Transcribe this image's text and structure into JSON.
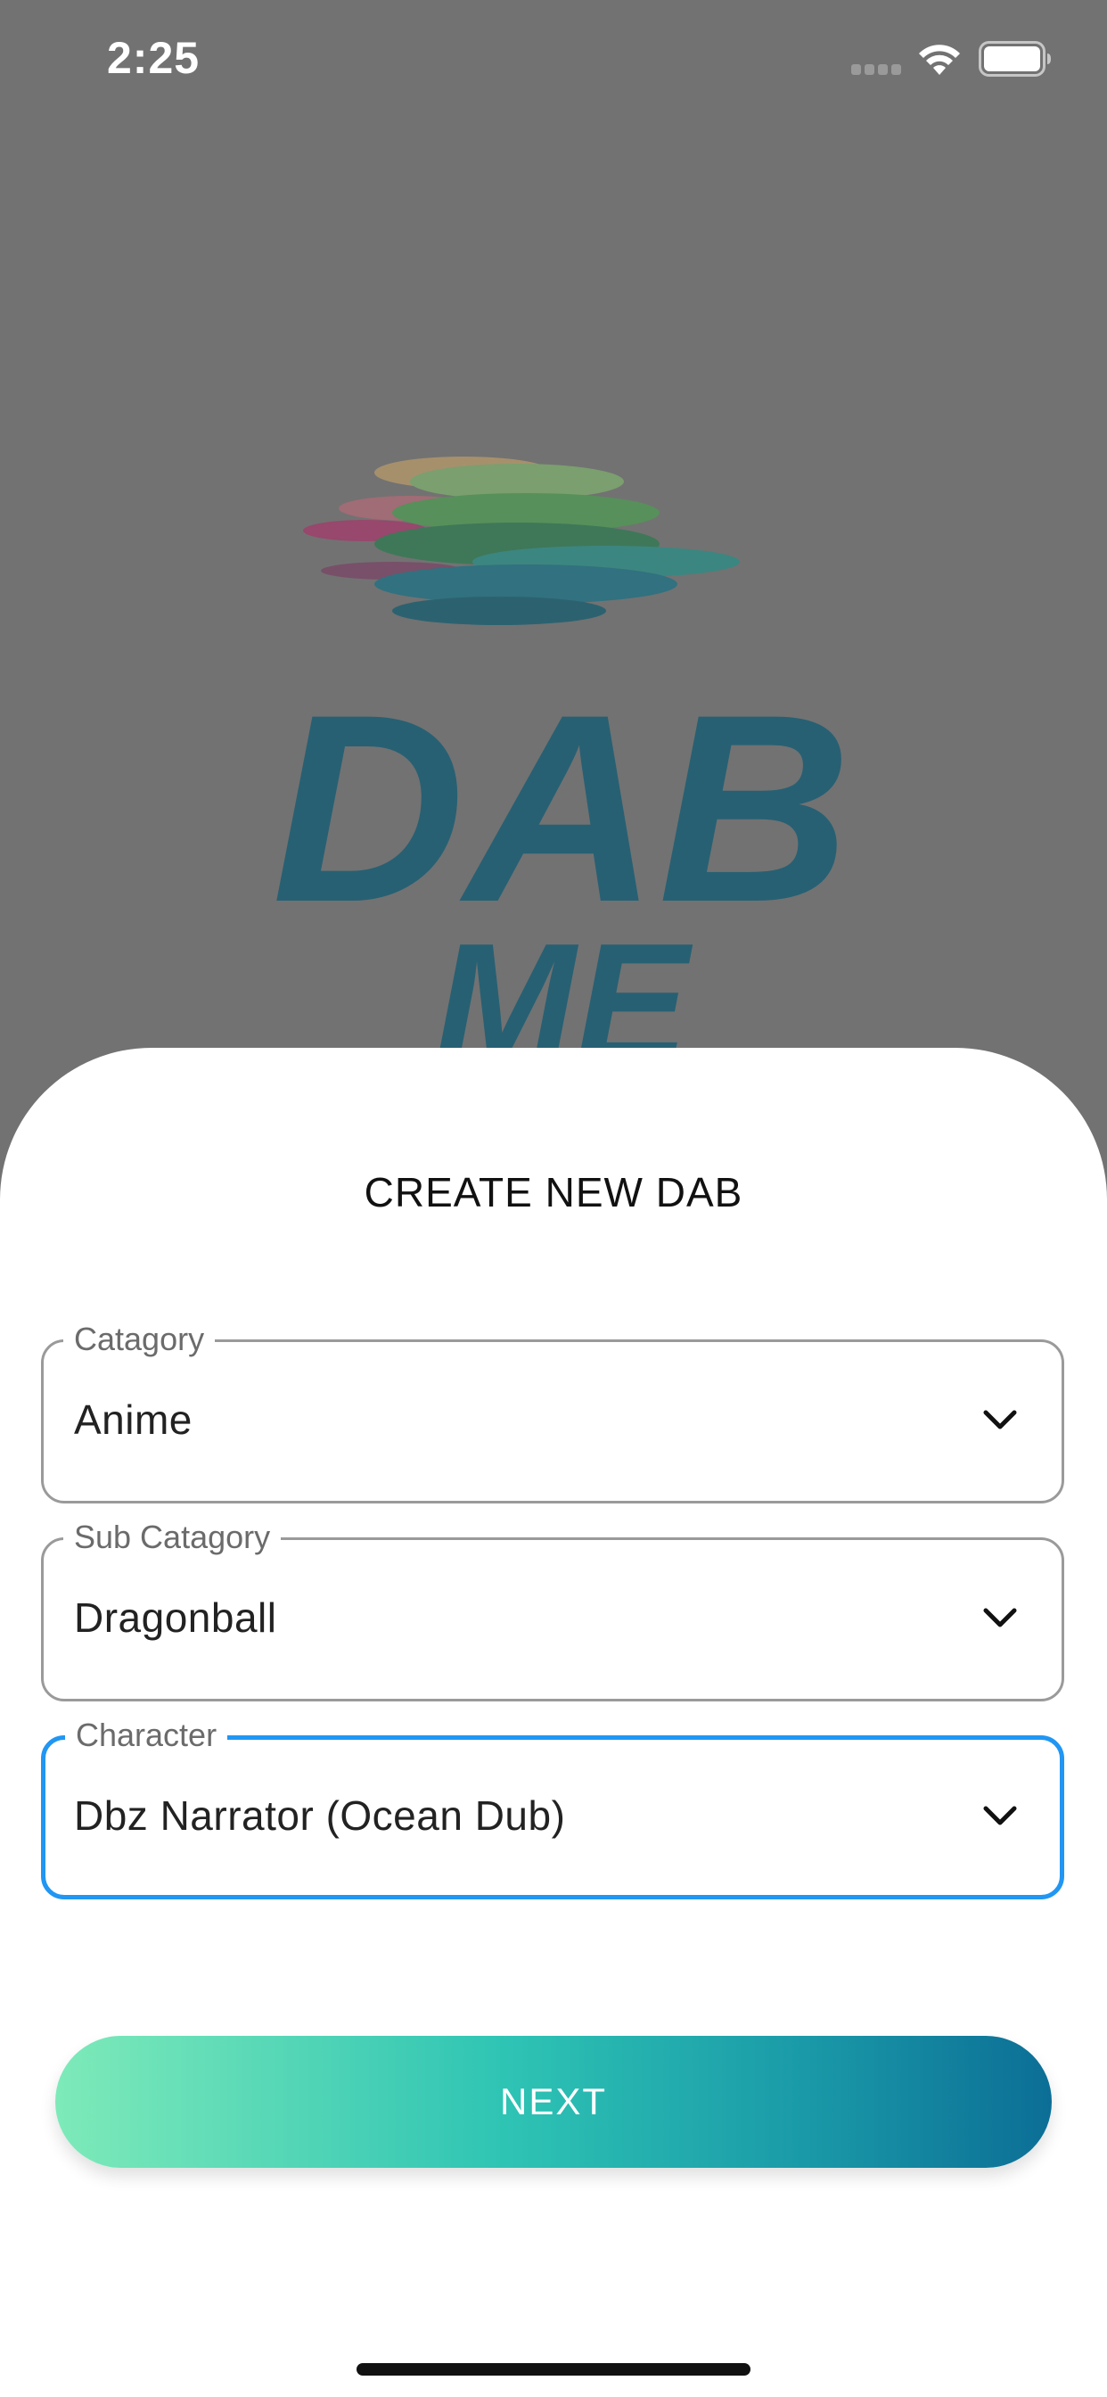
{
  "status_bar": {
    "time": "2:25",
    "icons": [
      "signal-icon",
      "wifi-icon",
      "battery-icon"
    ]
  },
  "background": {
    "logo_text": "DAB ME",
    "logo_color": "#1a5d74",
    "overlay_color": "#727272"
  },
  "sheet": {
    "title": "CREATE NEW DAB",
    "fields": [
      {
        "label": "Catagory",
        "value": "Anime",
        "focused": false
      },
      {
        "label": "Sub Catagory",
        "value": "Dragonball",
        "focused": false
      },
      {
        "label": "Character",
        "value": "Dbz Narrator (Ocean Dub)",
        "focused": true
      }
    ],
    "next_label": "NEXT"
  },
  "colors": {
    "focus": "#2196f3",
    "button_gradient_start": "#7eeab9",
    "button_gradient_end": "#0c6e96"
  }
}
